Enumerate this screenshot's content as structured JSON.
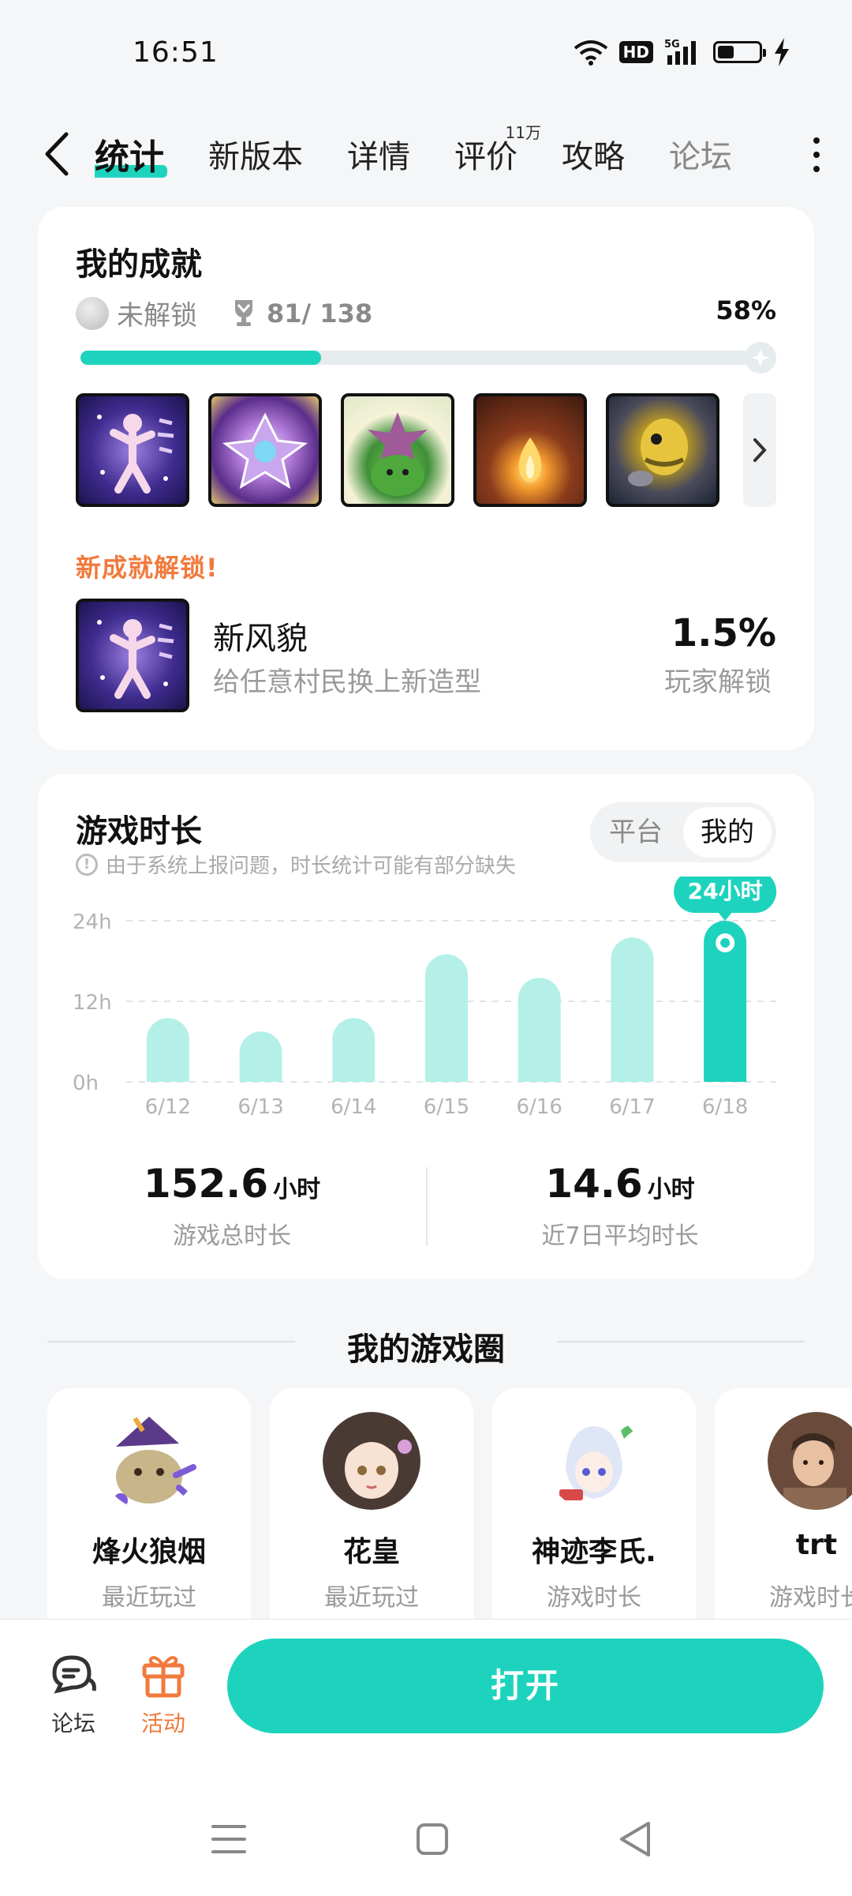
{
  "status_bar": {
    "time": "16:51",
    "hd": "HD",
    "network": "5G"
  },
  "nav": {
    "tabs": [
      {
        "label": "统计",
        "active": true
      },
      {
        "label": "新版本"
      },
      {
        "label": "详情"
      },
      {
        "label": "评价",
        "badge": "11万"
      },
      {
        "label": "攻略"
      },
      {
        "label": "论坛"
      }
    ]
  },
  "achievements": {
    "title": "我的成就",
    "locked_label": "未解锁",
    "count": "81/ 138",
    "percent_text": "58%",
    "progress": 0.58,
    "icons": [
      "new-look-badge-icon",
      "crystal-badge-icon",
      "plant-creature-badge-icon",
      "fire-cave-badge-icon",
      "golden-bee-badge-icon"
    ],
    "new_title": "新成就解锁!",
    "new": {
      "name": "新风貌",
      "desc": "给任意村民换上新造型",
      "rate": "1.5%",
      "rate_label": "玩家解锁"
    }
  },
  "playtime": {
    "title": "游戏时长",
    "note": "由于系统上报问题，时长统计可能有部分缺失",
    "toggle": {
      "platform": "平台",
      "mine": "我的"
    },
    "highlight_label": "24小时",
    "total_value": "152.6",
    "total_unit": "小时",
    "total_label": "游戏总时长",
    "avg_value": "14.6",
    "avg_unit": "小时",
    "avg_label": "近7日平均时长"
  },
  "chart_data": {
    "type": "bar",
    "categories": [
      "6/12",
      "6/13",
      "6/14",
      "6/15",
      "6/16",
      "6/17",
      "6/18"
    ],
    "values": [
      9.5,
      7.5,
      9.5,
      19,
      15.5,
      21.5,
      24
    ],
    "yticks": [
      "24h",
      "12h",
      "0h"
    ],
    "ylim": [
      0,
      24
    ],
    "highlight_index": 6,
    "colors": {
      "bar": "#b4f0e8",
      "highlight": "#1ed3bd"
    },
    "grid": true
  },
  "circle": {
    "title": "我的游戏圈",
    "friends": [
      {
        "name": "烽火狼烟",
        "sub": "最近玩过"
      },
      {
        "name": "花皇",
        "sub": "最近玩过"
      },
      {
        "name": "神迹李氏.",
        "sub": "游戏时长"
      },
      {
        "name": "trt",
        "sub": "游戏时长"
      }
    ]
  },
  "bottom": {
    "forum_label": "论坛",
    "activity_label": "活动",
    "open_label": "打开"
  },
  "colors": {
    "accent": "#1ed3bd",
    "orange": "#f07a3d"
  }
}
